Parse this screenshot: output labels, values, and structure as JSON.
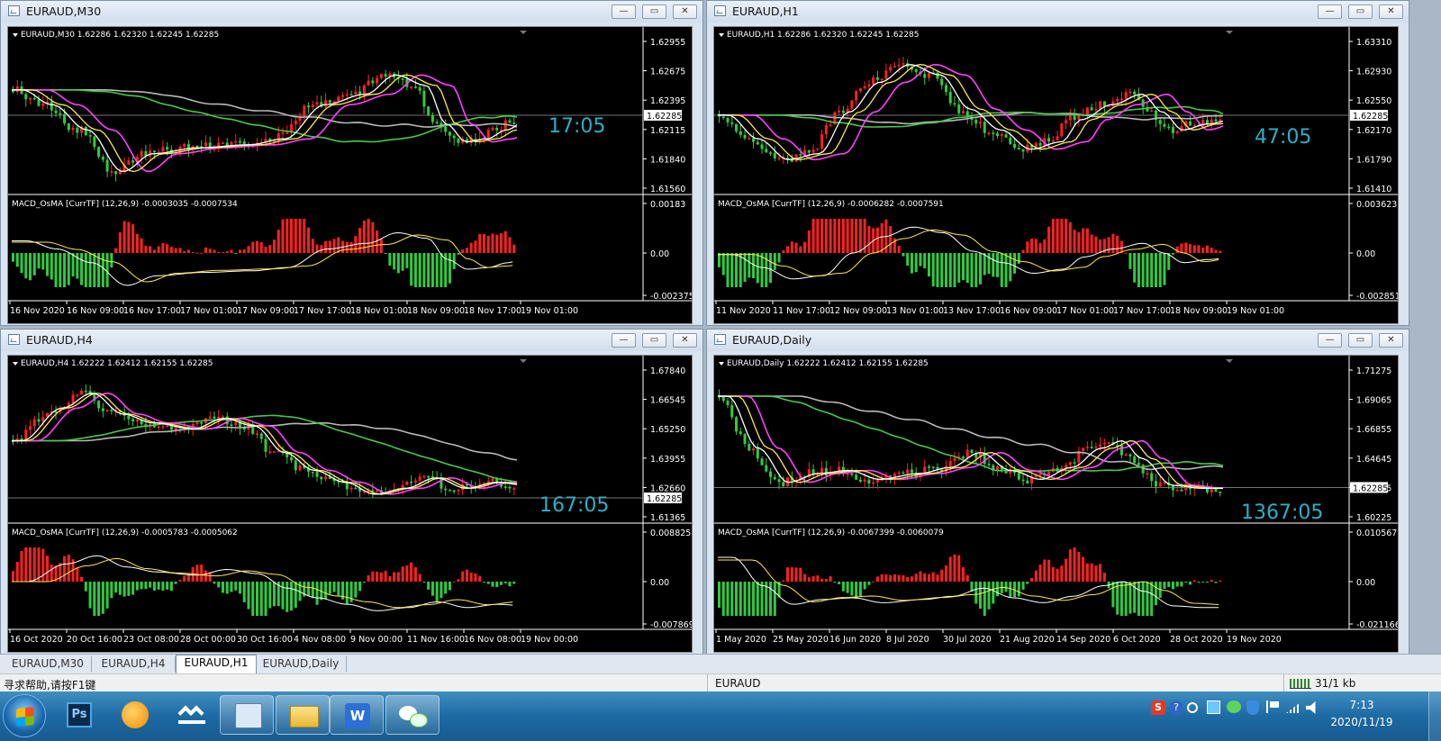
{
  "windows": [
    {
      "id": "m30",
      "title": "EURAUD,M30",
      "info": "EURAUD,M30  1.62286 1.62320 1.62245 1.62285",
      "price_ticks": [
        "1.62955",
        "1.62675",
        "1.62395",
        "1.62115",
        "1.61840",
        "1.61560"
      ],
      "current_price": "1.62285",
      "countdown": "17:05",
      "macd_label": "MACD_OsMA [CurrTF] (12,26,9) -0.0003035 -0.0007534",
      "macd_ticks": [
        "0.00183",
        "0.00",
        "-0.002375"
      ],
      "time_ticks": [
        "16 Nov 2020",
        "16 Nov 09:00",
        "16 Nov 17:00",
        "17 Nov 01:00",
        "17 Nov 09:00",
        "17 Nov 17:00",
        "18 Nov 01:00",
        "18 Nov 09:00",
        "18 Nov 17:00",
        "19 Nov 01:00"
      ]
    },
    {
      "id": "h1",
      "title": "EURAUD,H1",
      "info": "EURAUD,H1  1.62286 1.62320 1.62245 1.62285",
      "price_ticks": [
        "1.63310",
        "1.62930",
        "1.62550",
        "1.62170",
        "1.61790",
        "1.61410"
      ],
      "current_price": "1.62285",
      "countdown": "47:05",
      "macd_label": "MACD_OsMA [CurrTF] (12,26,9) -0.0006282 -0.0007591",
      "macd_ticks": [
        "0.0036232",
        "0.00",
        "-0.002851"
      ],
      "time_ticks": [
        "11 Nov 2020",
        "11 Nov 17:00",
        "12 Nov 09:00",
        "13 Nov 01:00",
        "13 Nov 17:00",
        "16 Nov 09:00",
        "17 Nov 01:00",
        "17 Nov 17:00",
        "18 Nov 09:00",
        "19 Nov 01:00"
      ]
    },
    {
      "id": "h4",
      "title": "EURAUD,H4",
      "info": "EURAUD,H4  1.62222 1.62412 1.62155 1.62285",
      "price_ticks": [
        "1.67840",
        "1.66545",
        "1.65250",
        "1.63955",
        "1.62660",
        "1.61365"
      ],
      "current_price": "1.62285",
      "countdown": "167:05",
      "macd_label": "MACD_OsMA [CurrTF] (12,26,9) -0.0005783 -0.0005062",
      "macd_ticks": [
        "0.0088254",
        "0.00",
        "-0.007869"
      ],
      "time_ticks": [
        "16 Oct 2020",
        "20 Oct 16:00",
        "23 Oct 08:00",
        "28 Oct 00:00",
        "30 Oct 16:00",
        "4 Nov 08:00",
        "9 Nov 00:00",
        "11 Nov 16:00",
        "16 Nov 08:00",
        "19 Nov 00:00"
      ]
    },
    {
      "id": "daily",
      "title": "EURAUD,Daily",
      "info": "EURAUD,Daily  1.62222 1.62412 1.62155 1.62285",
      "price_ticks": [
        "1.71275",
        "1.69065",
        "1.66855",
        "1.64645",
        "1.62285",
        "1.60225"
      ],
      "current_price": "1.62285",
      "countdown": "1367:05",
      "macd_label": "MACD_OsMA [CurrTF] (12,26,9) -0.0067399 -0.0060079",
      "macd_ticks": [
        "0.0105678",
        "0.00",
        "-0.021166"
      ],
      "time_ticks": [
        "1 May 2020",
        "25 May 2020",
        "16 Jun 2020",
        "8 Jul 2020",
        "30 Jul 2020",
        "21 Aug 2020",
        "14 Sep 2020",
        "6 Oct 2020",
        "28 Oct 2020",
        "19 Nov 2020"
      ]
    }
  ],
  "tabs": [
    "EURAUD,M30",
    "EURAUD,H4",
    "EURAUD,H1",
    "EURAUD,Daily"
  ],
  "active_tab": "EURAUD,H1",
  "status": {
    "help": "寻求帮助,请按F1键",
    "symbol": "EURAUD",
    "traffic": "31/1 kb"
  },
  "clock": {
    "time": "7:13",
    "date": "2020/11/19"
  },
  "colors": {
    "bull": "#ff2020",
    "bear": "#2ecc40",
    "ma_white": "#ffffff",
    "ma_yellow": "#ffe84a",
    "ma_magenta": "#ff40ff",
    "ma_green": "#48c848",
    "ma_gray": "#b8b8b8",
    "countdown": "#2bb0c8"
  }
}
